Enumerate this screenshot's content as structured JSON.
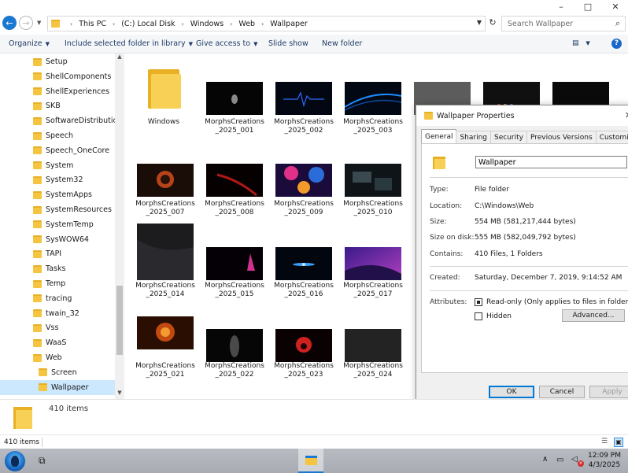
{
  "window": {
    "breadcrumbs": [
      "This PC",
      "(C:) Local Disk",
      "Windows",
      "Web",
      "Wallpaper"
    ],
    "search_placeholder": "Search Wallpaper",
    "controls": {
      "minimize": "–",
      "maximize": "□",
      "close": "✕"
    }
  },
  "toolbar": {
    "organize": "Organize",
    "include": "Include selected folder in library",
    "share": "Give access to",
    "slideshow": "Slide show",
    "newfolder": "New folder",
    "help": "?"
  },
  "nav": {
    "items": [
      "Setup",
      "ShellComponents",
      "ShellExperiences",
      "SKB",
      "SoftwareDistribution",
      "Speech",
      "Speech_OneCore",
      "System",
      "System32",
      "SystemApps",
      "SystemResources",
      "SystemTemp",
      "SysWOW64",
      "TAPI",
      "Tasks",
      "Temp",
      "tracing",
      "twain_32",
      "Vss",
      "WaaS",
      "Web",
      "Screen",
      "Wallpaper"
    ]
  },
  "files": [
    {
      "name": "Windows",
      "name2": ""
    },
    {
      "name": "MorphsCreations",
      "name2": "_2025_001"
    },
    {
      "name": "MorphsCreations",
      "name2": "_2025_002"
    },
    {
      "name": "MorphsCreations",
      "name2": "_2025_003"
    },
    {
      "name": "MorphsCreations",
      "name2": "_2025_007"
    },
    {
      "name": "MorphsCreations",
      "name2": "_2025_008"
    },
    {
      "name": "MorphsCreations",
      "name2": "_2025_009"
    },
    {
      "name": "MorphsCreations",
      "name2": "_2025_010"
    },
    {
      "name": "MorphsCreations",
      "name2": "_2025_014"
    },
    {
      "name": "MorphsCreations",
      "name2": "_2025_015"
    },
    {
      "name": "MorphsCreations",
      "name2": "_2025_016"
    },
    {
      "name": "MorphsCreations",
      "name2": "_2025_017"
    },
    {
      "name": "MorphsCreations",
      "name2": "_2025_021"
    },
    {
      "name": "MorphsCreations",
      "name2": "_2025_022"
    },
    {
      "name": "MorphsCreations",
      "name2": "_2025_023"
    },
    {
      "name": "MorphsCreations",
      "name2": "_2025_024"
    }
  ],
  "props": {
    "title": "Wallpaper Properties",
    "tabs": [
      "General",
      "Sharing",
      "Security",
      "Previous Versions",
      "Customize"
    ],
    "name": "Wallpaper",
    "type_label": "Type:",
    "type": "File folder",
    "location_label": "Location:",
    "location": "C:\\Windows\\Web",
    "size_label": "Size:",
    "size": "554 MB (581,217,444 bytes)",
    "disk_label": "Size on disk:",
    "disk": "555 MB (582,049,792 bytes)",
    "contains_label": "Contains:",
    "contains": "410 Files, 1 Folders",
    "created_label": "Created:",
    "created": "Saturday, December 7, 2019, 9:14:52 AM",
    "attr_label": "Attributes:",
    "readonly": "Read-only (Only applies to files in folder)",
    "hidden": "Hidden",
    "advanced": "Advanced...",
    "ok": "OK",
    "cancel": "Cancel",
    "apply": "Apply"
  },
  "details": {
    "count": "410 items"
  },
  "status": {
    "count": "410 items"
  },
  "taskbar": {
    "time": "12:09 PM",
    "date": "4/3/2025"
  }
}
